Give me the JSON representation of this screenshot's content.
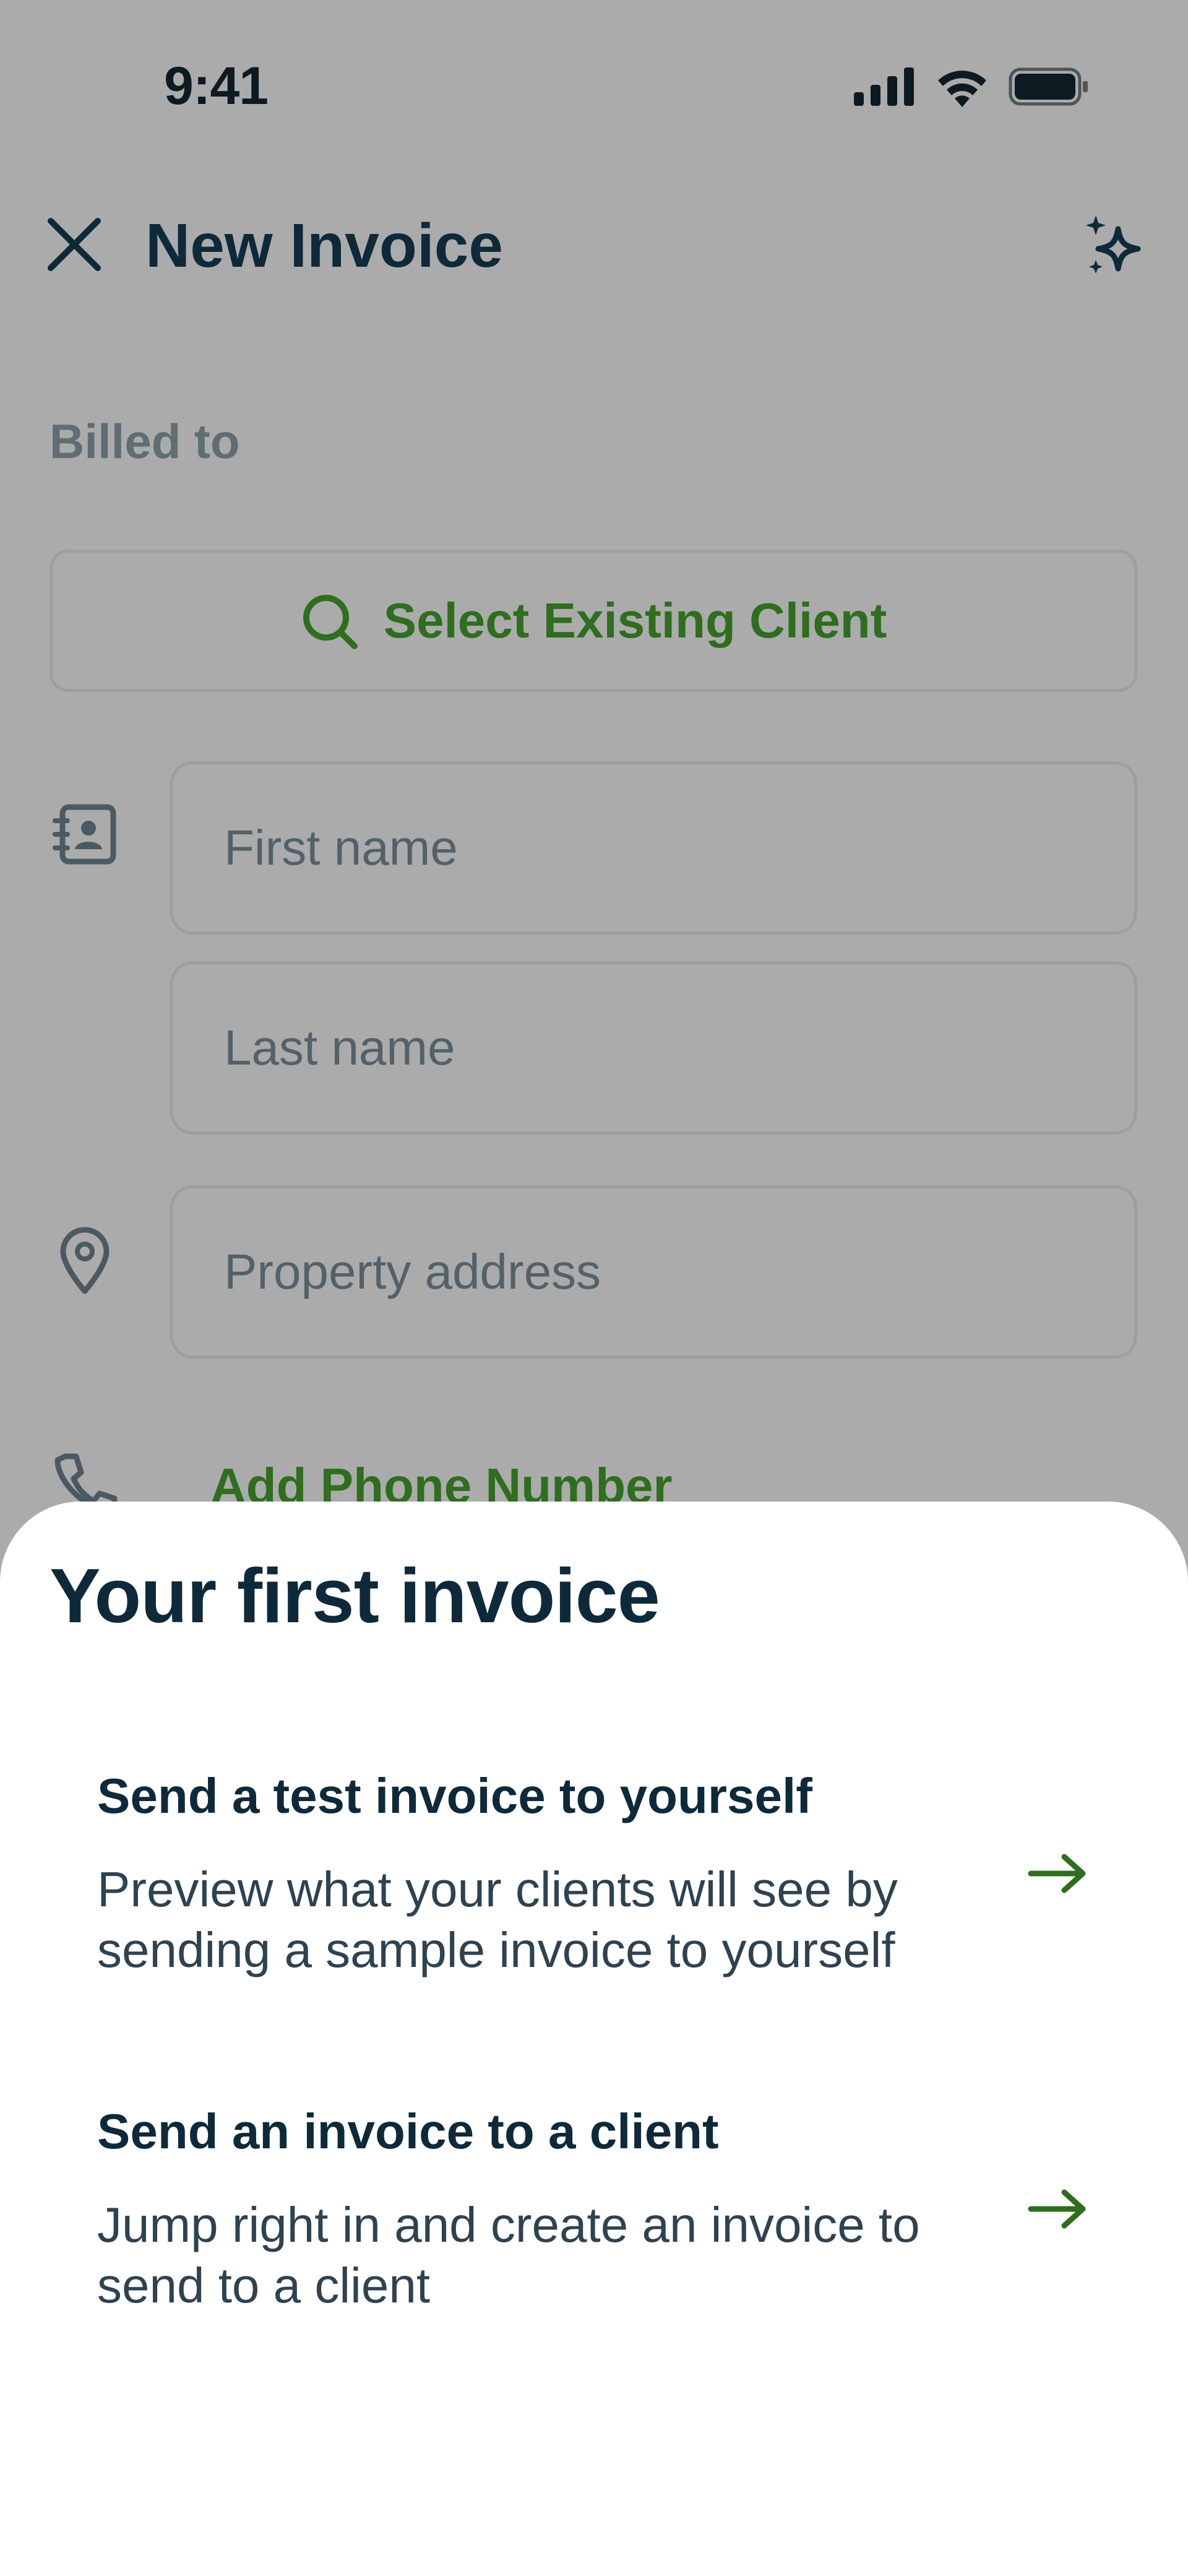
{
  "status_bar": {
    "time": "9:41"
  },
  "header": {
    "title": "New Invoice"
  },
  "form": {
    "billed_to_label": "Billed to",
    "select_client_label": "Select Existing Client",
    "first_name_placeholder": "First name",
    "last_name_placeholder": "Last name",
    "property_address_placeholder": "Property address",
    "add_phone_label": "Add Phone Number"
  },
  "sheet": {
    "title": "Your first invoice",
    "options": [
      {
        "title": "Send a test invoice to yourself",
        "description": "Preview what your clients will see by sending a sample invoice to yourself"
      },
      {
        "title": "Send an invoice to a client",
        "description": "Jump right in and create an invoice to send to a client"
      }
    ]
  },
  "colors": {
    "accent": "#2e6e1e",
    "heading": "#0e2a3a",
    "scrim": "#ababab"
  }
}
